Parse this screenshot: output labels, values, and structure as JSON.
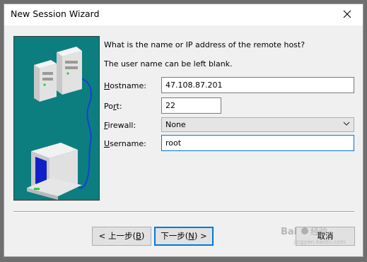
{
  "window": {
    "title": "New Session Wizard",
    "close_icon": "close-icon"
  },
  "prompts": {
    "line1": "What is the name or IP address of the remote host?",
    "line2": "The user name can be left blank."
  },
  "fields": {
    "hostname": {
      "label_pre": "",
      "label_acc": "H",
      "label_post": "ostname:",
      "value": "47.108.87.201"
    },
    "port": {
      "label_pre": "Po",
      "label_acc": "r",
      "label_post": "t:",
      "value": "22"
    },
    "firewall": {
      "label_pre": "",
      "label_acc": "F",
      "label_post": "irewall:",
      "value": "None"
    },
    "username": {
      "label_pre": "",
      "label_acc": "U",
      "label_post": "sername:",
      "value": "root"
    }
  },
  "buttons": {
    "back": {
      "pre": "< 上一步(",
      "acc": "B",
      "post": ")"
    },
    "next": {
      "pre": "下一步(",
      "acc": "N",
      "post": ") >"
    },
    "cancel": {
      "label": "取消"
    }
  },
  "colors": {
    "illustration_bg": "#0c7e80",
    "focus_border": "#0078d7"
  },
  "watermark": {
    "brand": "Bai",
    "brand2": "经验",
    "url": "jingyan.baidu.com"
  }
}
